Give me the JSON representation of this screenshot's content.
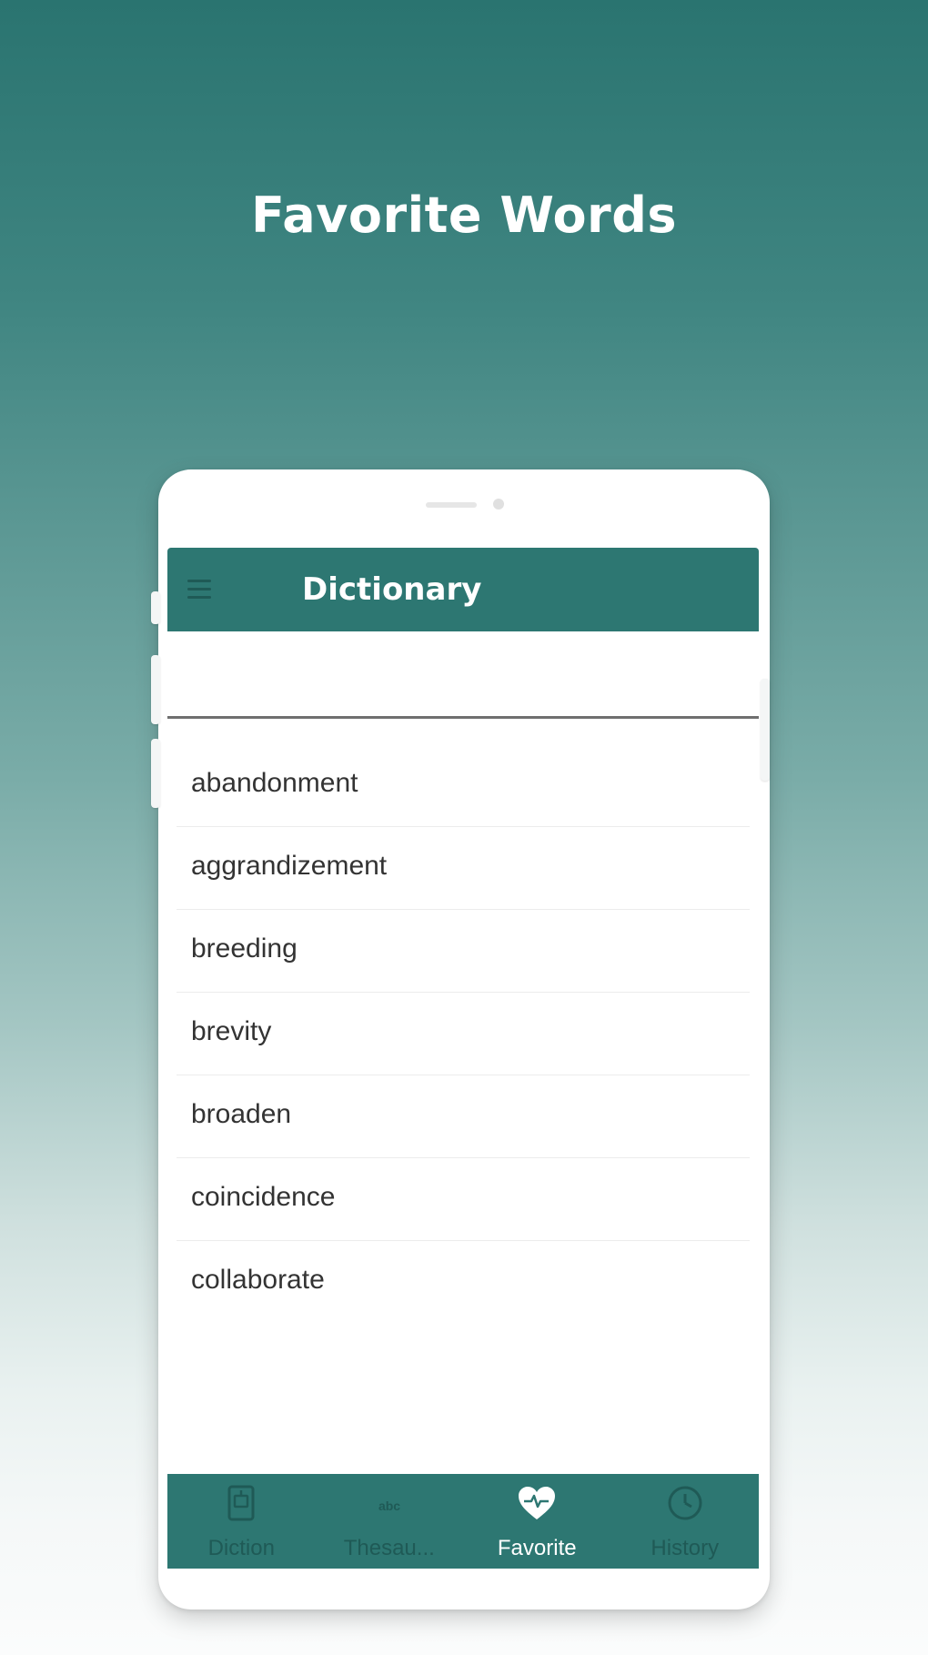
{
  "headline": "Favorite Words",
  "app_bar": {
    "menu_icon": "hamburger-menu-icon",
    "title": "Dictionary"
  },
  "search": {
    "value": "",
    "placeholder": ""
  },
  "favorite_words": [
    "abandonment",
    "aggrandizement",
    "breeding",
    "brevity",
    "broaden",
    "coincidence",
    "collaborate"
  ],
  "bottom_nav": [
    {
      "label": "Diction",
      "icon": "dictionary-book-icon",
      "active": false
    },
    {
      "label": "Thesau...",
      "icon": "thesaurus-abc-icon",
      "active": false
    },
    {
      "label": "Favorite",
      "icon": "heart-icon",
      "active": true
    },
    {
      "label": "History",
      "icon": "clock-icon",
      "active": false
    }
  ],
  "colors": {
    "primary": "#2d7772",
    "nav_inactive": "#1f5a56",
    "text": "#333333"
  }
}
